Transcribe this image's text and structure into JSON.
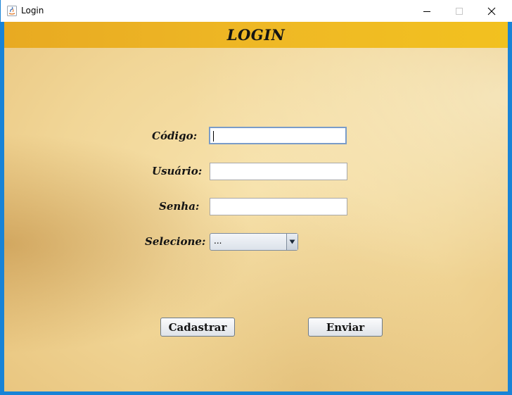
{
  "window": {
    "title": "Login",
    "app_icon": "java-icon",
    "controls": {
      "minimize": "minimize-icon",
      "maximize": "maximize-icon",
      "close": "close-icon"
    }
  },
  "header": {
    "title": "LOGIN"
  },
  "form": {
    "codigo": {
      "label": "Código:",
      "value": ""
    },
    "usuario": {
      "label": "Usuário:",
      "value": ""
    },
    "senha": {
      "label": "Senha:",
      "value": ""
    },
    "selecione": {
      "label": "Selecione:",
      "selected": "..."
    }
  },
  "buttons": {
    "cadastrar": "Cadastrar",
    "enviar": "Enviar"
  },
  "colors": {
    "header_band": "#efb925",
    "window_border": "#1883d7",
    "parchment": "#f1d697"
  }
}
